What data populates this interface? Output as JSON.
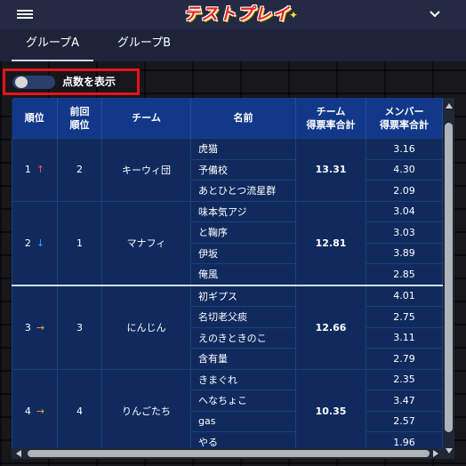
{
  "app": {
    "logo_text": "テストプレイ"
  },
  "tabs": [
    {
      "label": "グループA",
      "active": true
    },
    {
      "label": "グループB",
      "active": false
    }
  ],
  "toggle": {
    "label": "点数を表示",
    "on": false
  },
  "table": {
    "headers": {
      "rank": "順位",
      "prev_rank_line1": "前回",
      "prev_rank_line2": "順位",
      "team": "チーム",
      "name": "名前",
      "team_score_line1": "チーム",
      "team_score_line2": "得票率合計",
      "member_score_line1": "メンバー",
      "member_score_line2": "得票率合計"
    },
    "groups": [
      {
        "rank": "1",
        "trend": "↑",
        "trend_kind": "up",
        "prev_rank": "2",
        "team": "キーウィ団",
        "team_score": "13.31",
        "members": [
          {
            "name": "虎猫",
            "score": "3.16"
          },
          {
            "name": "予備校",
            "score": "4.30"
          },
          {
            "name": "あとひとつ流星群",
            "score": "2.09"
          }
        ]
      },
      {
        "rank": "2",
        "trend": "↓",
        "trend_kind": "down",
        "prev_rank": "1",
        "team": "マナフィ",
        "team_score": "12.81",
        "members": [
          {
            "name": "味本気アジ",
            "score": "3.04"
          },
          {
            "name": "と鞠序",
            "score": "3.03"
          },
          {
            "name": "伊坂",
            "score": "3.89"
          },
          {
            "name": "俺風",
            "score": "2.85"
          }
        ]
      },
      {
        "rank": "3",
        "trend": "→",
        "trend_kind": "right",
        "prev_rank": "3",
        "team": "にんじん",
        "team_score": "12.66",
        "members": [
          {
            "name": "初ギプス",
            "score": "4.01"
          },
          {
            "name": "名切老父痰",
            "score": "2.75"
          },
          {
            "name": "えのきときのこ",
            "score": "3.11"
          },
          {
            "name": "含有量",
            "score": "2.79"
          }
        ]
      },
      {
        "rank": "4",
        "trend": "→",
        "trend_kind": "right",
        "prev_rank": "4",
        "team": "りんごたち",
        "team_score": "10.35",
        "members": [
          {
            "name": "きまぐれ",
            "score": "2.35"
          },
          {
            "name": "へなちょこ",
            "score": "3.47"
          },
          {
            "name": "gas",
            "score": "2.57"
          },
          {
            "name": "やる",
            "score": "1.96"
          }
        ]
      }
    ]
  },
  "colors": {
    "header_bg": "#232a41",
    "table_header_bg": "#12388a",
    "table_body_bg": "#102a5e",
    "highlight_border": "#e4141b",
    "trend_up": "#ff4c5b",
    "trend_down": "#3d8cff",
    "trend_flat": "#ffa230"
  }
}
